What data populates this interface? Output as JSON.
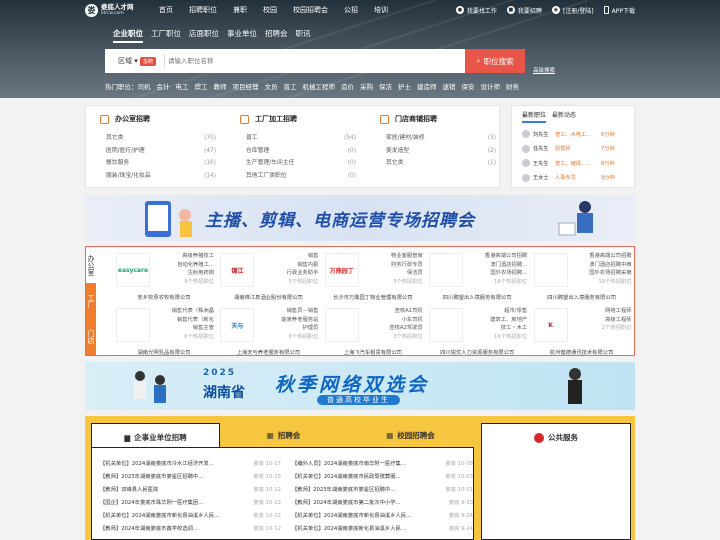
{
  "header": {
    "logo_title": "娄底人才网",
    "logo_sub": "ldrcw.com",
    "nav": [
      "首页",
      "招聘职位",
      "兼职",
      "校园",
      "校园招聘会",
      "公招",
      "培训"
    ],
    "links": [
      "我要找工作",
      "我要招聘",
      "[注册/登陆]",
      "APP下载"
    ]
  },
  "search": {
    "tabs": [
      "企业职位",
      "工厂职位",
      "店面职位",
      "事业单位",
      "招聘会",
      "职讯"
    ],
    "region": "区域",
    "hot_badge": "急聘",
    "placeholder": "请输入职位名称",
    "button": "职位搜索",
    "advanced": "高级搜索",
    "hot_label": "热门职位：",
    "hot": [
      "司机",
      "会计",
      "电工",
      "焊工",
      "教师",
      "项目经理",
      "文员",
      "普工",
      "机械工程师",
      "造价",
      "采购",
      "保洁",
      "护士",
      "建造师",
      "速销",
      "保安",
      "设计师",
      "财务"
    ]
  },
  "categories": [
    {
      "title": "办公室招聘",
      "items": [
        [
          "其它类",
          "(70)"
        ],
        [
          "医院/医疗/护理",
          "(47)"
        ],
        [
          "餐饮服务",
          "(16)"
        ],
        [
          "服装/珠宝/化妆品",
          "(14)"
        ]
      ]
    },
    {
      "title": "工厂加工招聘",
      "items": [
        [
          "普工",
          "(54)"
        ],
        [
          "仓库管理",
          "(0)"
        ],
        [
          "生产管理/车间主任",
          "(0)"
        ],
        [
          "其他工厂类职位",
          "(0)"
        ]
      ]
    },
    {
      "title": "门店商铺招聘",
      "items": [
        [
          "家居/建材/装修",
          "(3)"
        ],
        [
          "美发造型",
          "(2)"
        ],
        [
          "其它类",
          "(1)"
        ]
      ]
    }
  ],
  "news": {
    "tabs": [
      "最新职位",
      "最新动态"
    ],
    "rows": [
      {
        "name": "刘先生",
        "job": "普工、水电工...",
        "time": "6分钟"
      },
      {
        "name": "任先生",
        "job": "厨帮师",
        "time": "7分钟"
      },
      {
        "name": "王先生",
        "job": "普工、镀焊、...",
        "time": "8分钟"
      },
      {
        "name": "王女士",
        "job": "人事专员",
        "time": "9分钟"
      }
    ]
  },
  "banner1": {
    "text": "主播、剪辑、电商运营专场招聘会"
  },
  "companies": {
    "vtabs": [
      "办公室",
      "工厂",
      "门店"
    ],
    "cards": [
      {
        "logo": "easycare",
        "jobs": [
          "高级养猪技工",
          "自动化养殖工...",
          "注射用药岗"
        ],
        "count": "9个热招职位",
        "name": "安乡牧原农牧有限公司"
      },
      {
        "logo": "锦江",
        "jobs": [
          "销售",
          "销售内勤",
          "行政业务助手"
        ],
        "count": "5个热招职位",
        "name": "湖南锦江泉酒业股份有限公司"
      },
      {
        "logo": "万鼎园丁",
        "jobs": [
          "物业客服管家",
          "财务行政专员",
          "保洁员"
        ],
        "count": "3个热招职位",
        "name": "长沙市万鼎园丁物业管理有限公司"
      },
      {
        "logo": "",
        "jobs": [
          "香港高端公司招聘",
          "澳门酒店招聘...",
          "国外农场招聘..."
        ],
        "count": "18个热招职位",
        "name": "四川聘望出入境服务有限公司"
      },
      {
        "logo": "",
        "jobs": [
          "香港高端公司招聘",
          "澳门酒店招聘中西",
          "国外农场招聘采摘"
        ],
        "count": "18个热招职位",
        "name": "四川聘望出入境服务有限公司"
      },
      {
        "logo": "",
        "jobs": [
          "销售代表（株洲晶",
          "销售代表（新化",
          "销售主管"
        ],
        "count": "6个热招职位",
        "name": "湖南光明乳品有限公司"
      },
      {
        "logo": "天与",
        "jobs": [
          "销售员－销售",
          "能家养老服务站",
          "护理员"
        ],
        "count": "6个热招职位",
        "name": "上海天与养老服务有限公司"
      },
      {
        "logo": "",
        "jobs": [
          "查核A1司机",
          "小车司机",
          "查核A2驾驶员"
        ],
        "count": "3个热招职位",
        "name": "上海飞汽车租赁有限公司"
      },
      {
        "logo": "",
        "jobs": [
          "超市/零售",
          "建筑工、房地产",
          "技工・木工"
        ],
        "count": "16个热招职位",
        "name": "四川锐优人力资源服务有限公司"
      },
      {
        "logo": "K",
        "jobs": [
          "网络工程师",
          "",
          "高级工程师"
        ],
        "count": "2个热招职位",
        "name": "杭州健德通讯技术有限公司"
      }
    ]
  },
  "banner2": {
    "year": "2025",
    "province": "湖南省",
    "title": "秋季网络双选会",
    "sub": "普通高校毕业生"
  },
  "bottom": {
    "tabs": [
      "企事业单位招聘",
      "招聘会",
      "校园招聘会"
    ],
    "public": "公共服务",
    "left": [
      [
        "【机关单位】2024湖南娄底市冷水江经济开发...",
        "娄底 10-17"
      ],
      [
        "【教师】2023年湖南娄底市娄星区招聘中...",
        "娄底 10-15"
      ],
      [
        "【教师】双峰县人民医院",
        "娄底 10-12"
      ],
      [
        "【国企】2024年娄底市珠华刚一医疗集团...",
        "娄底 10-12"
      ],
      [
        "【机关单位】2024湖南娄底市新化县油溪乡人民...",
        "娄底 10-12"
      ],
      [
        "【教师】2024年湖南娄底市鑫学校选调...",
        "娄底 10-12"
      ]
    ],
    "right": [
      [
        "【编外人员】2024湖南娄底市南华附一医疗集...",
        "娄底 10-08"
      ],
      [
        "【机关单位】2024湖南娄底市民政局殡葬服...",
        "娄底 10-03"
      ],
      [
        "【教师】2023年湖南娄底市娄星区招聘中...",
        "娄底 10-01"
      ],
      [
        "【教师】2024年湖南娄底市第二批次中小学...",
        "娄底 9-30"
      ],
      [
        "【机关单位】2024湖南娄底市新化县油溪乡人民...",
        "娄底 9-24"
      ],
      [
        "【机关单位】2024湖南娄底新化县油溪乡人民...",
        "娄底 9-24"
      ]
    ]
  }
}
